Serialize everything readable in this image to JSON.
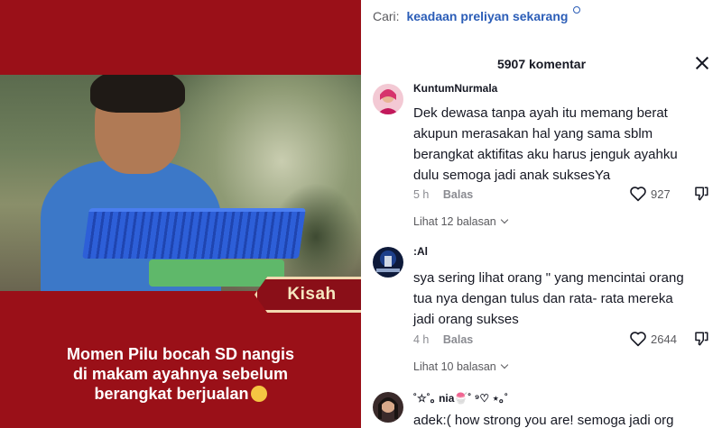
{
  "video": {
    "tag": "Kisah",
    "caption_lines": [
      "Momen Pilu bocah SD nangis",
      "di makam ayahnya sebelum",
      "berangkat berjualan"
    ]
  },
  "panel": {
    "search_label": "Cari:",
    "search_term": "keadaan preliyan sekarang",
    "comment_count": "5907 komentar"
  },
  "comments": [
    {
      "author": "KuntumNurmala",
      "lines": [
        "Dek dewasa tanpa ayah itu memang berat",
        "akupun merasakan hal yang sama sblm",
        "berangkat aktifitas aku harus jenguk ayahku",
        "dulu semoga jadi anak suksesYa"
      ],
      "time": "5 h",
      "reply_label": "Balas",
      "likes": "927",
      "view_replies": "Lihat 12 balasan"
    },
    {
      "author": ":Al",
      "lines": [
        "sya sering lihat orang \" yang mencintai orang",
        "tua nya dengan tulus dan rata- rata mereka",
        "jadi orang sukses"
      ],
      "time": "4 h",
      "reply_label": "Balas",
      "likes": "2644",
      "view_replies": "Lihat 10 balasan"
    },
    {
      "author": "˚☆˚｡ nia🍧˚ ⁹♡ ⋆｡˚",
      "lines": [
        "adek:( how strong you are! semoga jadi org"
      ]
    }
  ]
}
